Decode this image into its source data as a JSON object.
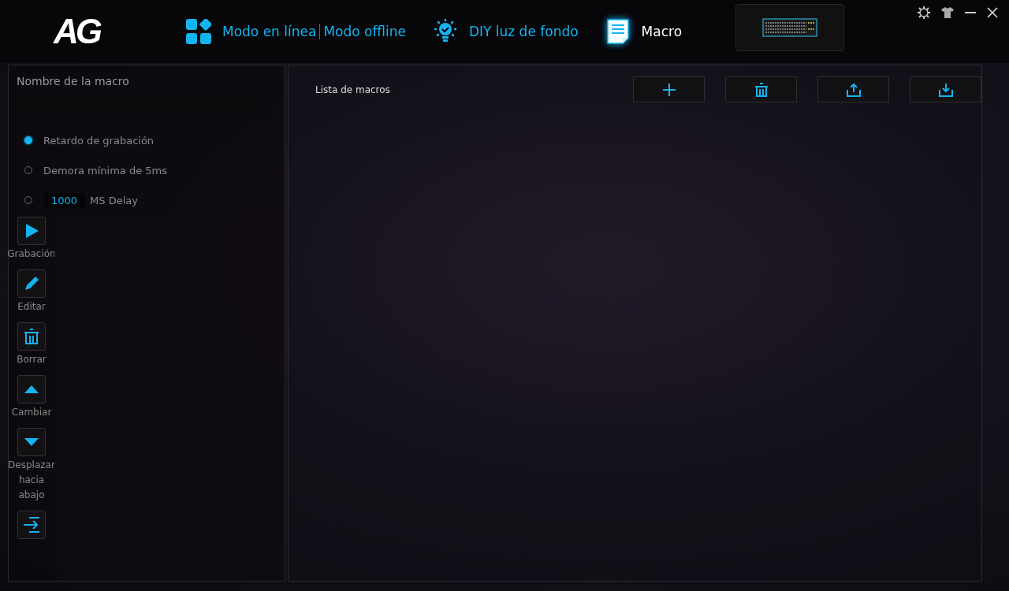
{
  "logo": {
    "text": "AG"
  },
  "tabs": [
    {
      "kind": "mode",
      "labels": [
        "Modo en línea",
        "Modo offline"
      ],
      "selected": false
    },
    {
      "kind": "light",
      "labels": [
        "DIY luz de fondo"
      ],
      "selected": false
    },
    {
      "kind": "macro",
      "labels": [
        "Macro"
      ],
      "selected": true
    }
  ],
  "macro_panel": {
    "name_label": "Nombre de la macro",
    "options": [
      {
        "kind": "text",
        "label": "Retardo de grabación",
        "selected": true
      },
      {
        "kind": "text",
        "label": "Demora mínima de 5ms",
        "selected": false
      },
      {
        "kind": "delay",
        "value": "1000",
        "label": "MS Delay",
        "selected": false
      }
    ],
    "tools": [
      {
        "kind": "play",
        "label": "Grabación"
      },
      {
        "kind": "pencil",
        "label": "Editar"
      },
      {
        "kind": "trash",
        "label": "Borrar"
      },
      {
        "kind": "up",
        "label": "Cambiar"
      },
      {
        "kind": "down",
        "label": "Desplazar hacia abajo"
      },
      {
        "kind": "insert"
      }
    ]
  },
  "macro_list": {
    "title": "Lista de macros",
    "buttons": [
      {
        "kind": "add"
      },
      {
        "kind": "trash"
      },
      {
        "kind": "upload"
      },
      {
        "kind": "download"
      }
    ]
  }
}
